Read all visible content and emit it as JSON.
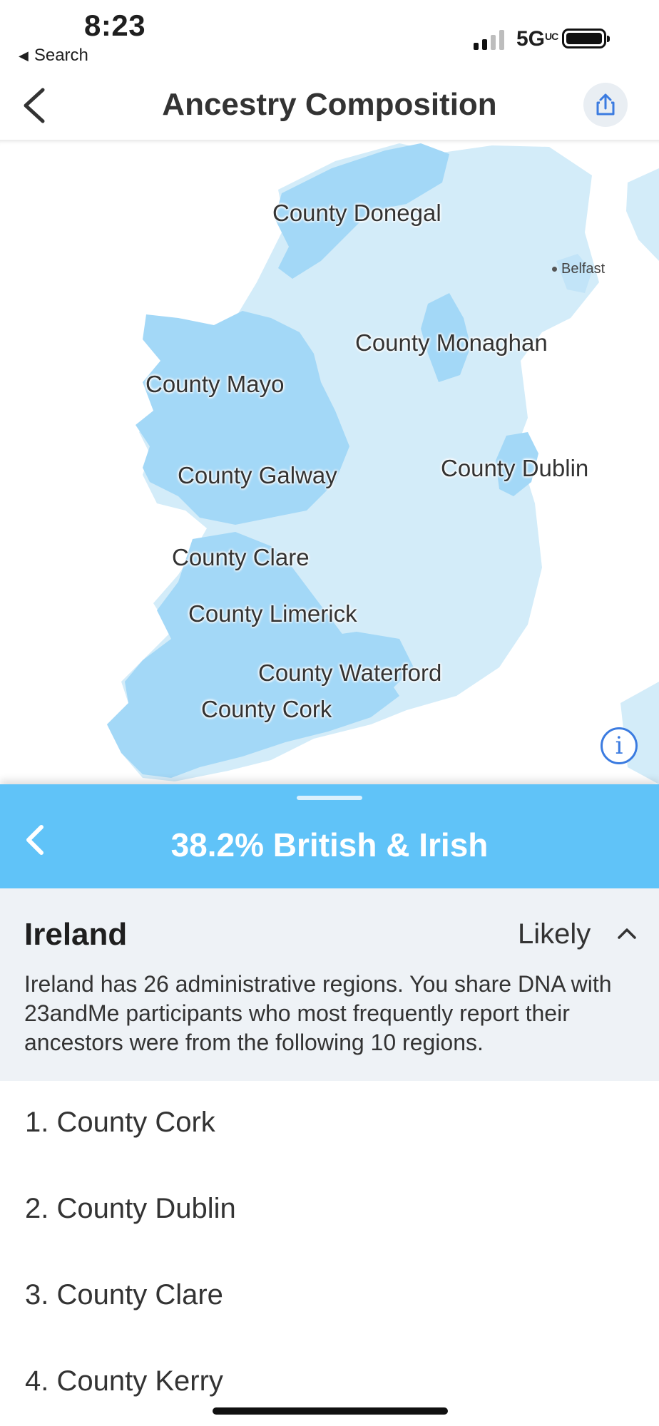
{
  "status_bar": {
    "time": "8:23",
    "back_app": "Search",
    "network": "5G",
    "network_sup": "UC"
  },
  "nav": {
    "title": "Ancestry Composition"
  },
  "map": {
    "labels": {
      "donegal": "County Donegal",
      "monaghan": "County Monaghan",
      "mayo": "County Mayo",
      "galway": "County Galway",
      "dublin": "County Dublin",
      "clare": "County Clare",
      "limerick": "County Limerick",
      "waterford": "County Waterford",
      "cork": "County Cork"
    },
    "city": "Belfast",
    "colors": {
      "land_light": "#d3ecf9",
      "land_highlight": "#a3d8f7"
    }
  },
  "sheet": {
    "title": "38.2% British & Irish",
    "color": "#60c3f8"
  },
  "detail": {
    "region": "Ireland",
    "confidence": "Likely",
    "description": "Ireland has 26 administrative regions. You share DNA with 23andMe participants who most frequently report their ancestors were from the following 10 regions."
  },
  "regions": [
    "1. County Cork",
    "2. County Dublin",
    "3. County Clare",
    "4. County Kerry"
  ]
}
